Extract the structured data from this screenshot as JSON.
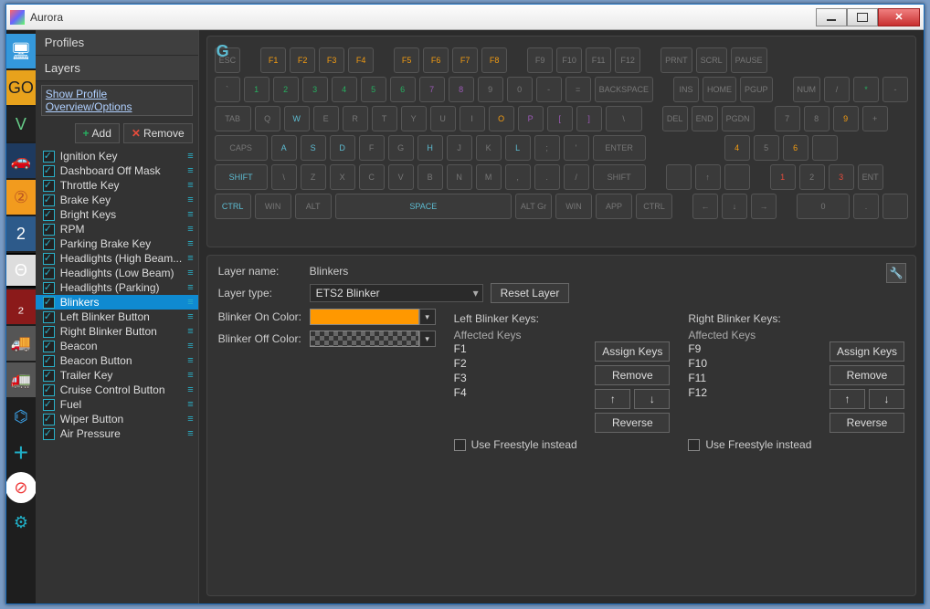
{
  "window": {
    "title": "Aurora"
  },
  "panel": {
    "profiles_header": "Profiles",
    "layers_header": "Layers",
    "options_link": "Show Profile Overview/Options",
    "add_label": "Add",
    "remove_label": "Remove"
  },
  "layers": [
    {
      "label": "Ignition Key",
      "checked": true,
      "sel": false
    },
    {
      "label": "Dashboard Off Mask",
      "checked": true,
      "sel": false
    },
    {
      "label": "Throttle Key",
      "checked": true,
      "sel": false
    },
    {
      "label": "Brake Key",
      "checked": true,
      "sel": false
    },
    {
      "label": "Bright Keys",
      "checked": true,
      "sel": false
    },
    {
      "label": "RPM",
      "checked": true,
      "sel": false
    },
    {
      "label": "Parking Brake Key",
      "checked": true,
      "sel": false
    },
    {
      "label": "Headlights (High Beam...",
      "checked": true,
      "sel": false
    },
    {
      "label": "Headlights (Low Beam)",
      "checked": true,
      "sel": false
    },
    {
      "label": "Headlights (Parking)",
      "checked": true,
      "sel": false
    },
    {
      "label": "Blinkers",
      "checked": true,
      "sel": true
    },
    {
      "label": "Left Blinker Button",
      "checked": true,
      "sel": false
    },
    {
      "label": "Right Blinker Button",
      "checked": true,
      "sel": false
    },
    {
      "label": "Beacon",
      "checked": true,
      "sel": false
    },
    {
      "label": "Beacon Button",
      "checked": true,
      "sel": false
    },
    {
      "label": "Trailer Key",
      "checked": true,
      "sel": false
    },
    {
      "label": "Cruise Control Button",
      "checked": true,
      "sel": false
    },
    {
      "label": "Fuel",
      "checked": true,
      "sel": false
    },
    {
      "label": "Wiper Button",
      "checked": true,
      "sel": false
    },
    {
      "label": "Air Pressure",
      "checked": true,
      "sel": false
    }
  ],
  "detail": {
    "layer_name_label": "Layer name:",
    "layer_name_value": "Blinkers",
    "layer_type_label": "Layer type:",
    "layer_type_value": "ETS2 Blinker",
    "reset_label": "Reset Layer",
    "on_color_label": "Blinker On Color:",
    "off_color_label": "Blinker Off Color:",
    "on_color_hex": "#ff9800",
    "left_header": "Left Blinker Keys:",
    "right_header": "Right Blinker Keys:",
    "affected_label": "Affected Keys",
    "assign_label": "Assign Keys",
    "remove_key_label": "Remove",
    "up_label": "↑",
    "down_label": "↓",
    "reverse_label": "Reverse",
    "freestyle_label": "Use Freestyle instead",
    "left_keys": [
      "F1",
      "F2",
      "F3",
      "F4"
    ],
    "right_keys": [
      "F9",
      "F10",
      "F11",
      "F12"
    ]
  },
  "keyboard": {
    "row0": [
      {
        "t": "ESC",
        "c": ""
      },
      {
        "gap": 1
      },
      {
        "t": "F1",
        "c": "on"
      },
      {
        "t": "F2",
        "c": "on"
      },
      {
        "t": "F3",
        "c": "on"
      },
      {
        "t": "F4",
        "c": "on"
      },
      {
        "gap": 1
      },
      {
        "t": "F5",
        "c": "on"
      },
      {
        "t": "F6",
        "c": "on"
      },
      {
        "t": "F7",
        "c": "on"
      },
      {
        "t": "F8",
        "c": "on"
      },
      {
        "gap": 1
      },
      {
        "t": "F9",
        "c": ""
      },
      {
        "t": "F10",
        "c": ""
      },
      {
        "t": "F11",
        "c": ""
      },
      {
        "t": "F12",
        "c": ""
      },
      {
        "gap": 1
      },
      {
        "t": "PRNT",
        "c": ""
      },
      {
        "t": "SCRL",
        "c": ""
      },
      {
        "t": "PAUSE",
        "c": ""
      }
    ],
    "row1": [
      {
        "t": "`",
        "c": ""
      },
      {
        "t": "1",
        "c": "gr"
      },
      {
        "t": "2",
        "c": "gr"
      },
      {
        "t": "3",
        "c": "gr"
      },
      {
        "t": "4",
        "c": "gr"
      },
      {
        "t": "5",
        "c": "gr"
      },
      {
        "t": "6",
        "c": "gr"
      },
      {
        "t": "7",
        "c": "pu"
      },
      {
        "t": "8",
        "c": "pu"
      },
      {
        "t": "9",
        "c": ""
      },
      {
        "t": "0",
        "c": ""
      },
      {
        "t": "-",
        "c": ""
      },
      {
        "t": "=",
        "c": ""
      },
      {
        "t": "BACKSPACE",
        "c": "",
        "w": "xl"
      },
      {
        "gap": 1
      },
      {
        "t": "INS",
        "c": ""
      },
      {
        "t": "HOME",
        "c": ""
      },
      {
        "t": "PGUP",
        "c": ""
      },
      {
        "gap": 1
      },
      {
        "t": "NUM",
        "c": ""
      },
      {
        "t": "/",
        "c": ""
      },
      {
        "t": "*",
        "c": "gr"
      },
      {
        "t": "-",
        "c": ""
      }
    ],
    "row2": [
      {
        "t": "TAB",
        "c": "",
        "w": "lg"
      },
      {
        "t": "Q",
        "c": ""
      },
      {
        "t": "W",
        "c": "cy"
      },
      {
        "t": "E",
        "c": ""
      },
      {
        "t": "R",
        "c": ""
      },
      {
        "t": "T",
        "c": ""
      },
      {
        "t": "Y",
        "c": ""
      },
      {
        "t": "U",
        "c": ""
      },
      {
        "t": "I",
        "c": ""
      },
      {
        "t": "O",
        "c": "on"
      },
      {
        "t": "P",
        "c": "pu"
      },
      {
        "t": "[",
        "c": "pu"
      },
      {
        "t": "]",
        "c": "pu"
      },
      {
        "t": "\\",
        "c": "",
        "w": "lg"
      },
      {
        "gap": 1
      },
      {
        "t": "DEL",
        "c": ""
      },
      {
        "t": "END",
        "c": ""
      },
      {
        "t": "PGDN",
        "c": ""
      },
      {
        "gap": 1
      },
      {
        "t": "7",
        "c": ""
      },
      {
        "t": "8",
        "c": ""
      },
      {
        "t": "9",
        "c": "on"
      },
      {
        "t": "+",
        "c": ""
      }
    ],
    "row3": [
      {
        "t": "CAPS",
        "c": "",
        "w": "xl"
      },
      {
        "t": "A",
        "c": "cy"
      },
      {
        "t": "S",
        "c": "cy"
      },
      {
        "t": "D",
        "c": "cy"
      },
      {
        "t": "F",
        "c": ""
      },
      {
        "t": "G",
        "c": ""
      },
      {
        "t": "H",
        "c": "cy"
      },
      {
        "t": "J",
        "c": ""
      },
      {
        "t": "K",
        "c": ""
      },
      {
        "t": "L",
        "c": "cy"
      },
      {
        "t": ";",
        "c": ""
      },
      {
        "t": "'",
        "c": ""
      },
      {
        "t": "ENTER",
        "c": "",
        "w": "xl"
      },
      {
        "gap": 2
      },
      {
        "gap": 2
      },
      {
        "gap": 1
      },
      {
        "t": "4",
        "c": "on"
      },
      {
        "t": "5",
        "c": ""
      },
      {
        "t": "6",
        "c": "on"
      },
      {
        "t": "",
        "c": ""
      }
    ],
    "row4": [
      {
        "t": "SHIFT",
        "c": "cy",
        "w": "xl"
      },
      {
        "t": "\\",
        "c": ""
      },
      {
        "t": "Z",
        "c": ""
      },
      {
        "t": "X",
        "c": ""
      },
      {
        "t": "C",
        "c": ""
      },
      {
        "t": "V",
        "c": ""
      },
      {
        "t": "B",
        "c": ""
      },
      {
        "t": "N",
        "c": ""
      },
      {
        "t": "M",
        "c": ""
      },
      {
        "t": ",",
        "c": ""
      },
      {
        "t": ".",
        "c": ""
      },
      {
        "t": "/",
        "c": ""
      },
      {
        "t": "SHIFT",
        "c": "",
        "w": "xl"
      },
      {
        "gap": 1
      },
      {
        "t": "",
        "c": ""
      },
      {
        "t": "↑",
        "c": ""
      },
      {
        "t": "",
        "c": ""
      },
      {
        "gap": 1
      },
      {
        "t": "1",
        "c": "rd"
      },
      {
        "t": "2",
        "c": ""
      },
      {
        "t": "3",
        "c": "rd"
      },
      {
        "t": "ENT",
        "c": ""
      }
    ],
    "row5": [
      {
        "t": "CTRL",
        "c": "cy",
        "w": "lg"
      },
      {
        "t": "WIN",
        "c": "",
        "w": "lg"
      },
      {
        "t": "ALT",
        "c": "",
        "w": "lg"
      },
      {
        "t": "SPACE",
        "c": "cy",
        "w": "spc"
      },
      {
        "t": "ALT Gr",
        "c": "",
        "w": "lg"
      },
      {
        "t": "WIN",
        "c": "",
        "w": "lg"
      },
      {
        "t": "APP",
        "c": "",
        "w": "lg"
      },
      {
        "t": "CTRL",
        "c": "",
        "w": "lg"
      },
      {
        "gap": 1
      },
      {
        "t": "←",
        "c": ""
      },
      {
        "t": "↓",
        "c": ""
      },
      {
        "t": "→",
        "c": ""
      },
      {
        "gap": 1
      },
      {
        "t": "0",
        "c": "",
        "w": "xl"
      },
      {
        "t": ".",
        "c": ""
      },
      {
        "t": "",
        "c": ""
      }
    ]
  }
}
